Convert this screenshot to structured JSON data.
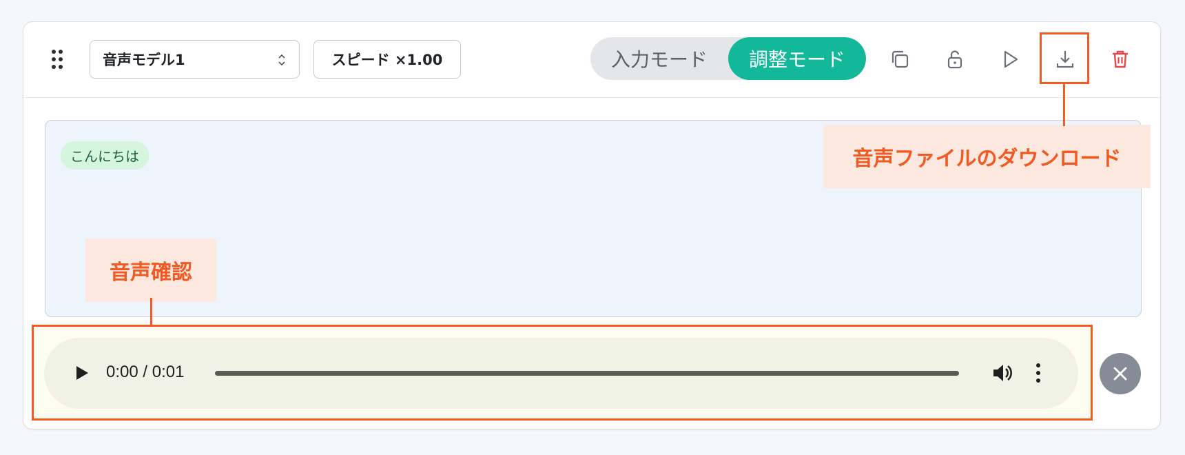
{
  "toolbar": {
    "model_select_value": "音声モデル1",
    "speed_label": "スピード ×1.00",
    "mode_input_label": "入力モード",
    "mode_adjust_label": "調整モード",
    "icons": [
      "copy-icon",
      "unlock-icon",
      "play-icon",
      "download-icon",
      "trash-icon"
    ]
  },
  "editor": {
    "chip_text": "こんにちは"
  },
  "audio": {
    "time_text": "0:00 / 0:01"
  },
  "annotations": {
    "confirm_label": "音声確認",
    "download_label": "音声ファイルのダウンロード"
  },
  "colors": {
    "accent_teal": "#13b89a",
    "annotation_orange": "#f15a22",
    "trash_red": "#e5484d"
  }
}
